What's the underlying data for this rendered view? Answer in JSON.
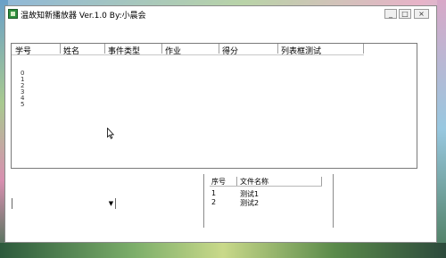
{
  "window": {
    "title": "温故知新播放器 Ver.1.0 By:小晨会",
    "buttons": {
      "minimize": "_",
      "maximize": "□",
      "close": "×"
    }
  },
  "main_list": {
    "columns": [
      "学号",
      "姓名",
      "事件类型",
      "作业",
      "得分",
      "列表框测试"
    ],
    "row_numbers": [
      "0",
      "1",
      "2",
      "3",
      "4",
      "5"
    ]
  },
  "combo": {
    "value": "",
    "arrow": "▼"
  },
  "side_list": {
    "columns": [
      "序号",
      "文件名称"
    ],
    "rows": [
      {
        "index": "1",
        "name": "测试1"
      },
      {
        "index": "2",
        "name": "测试2"
      }
    ]
  }
}
